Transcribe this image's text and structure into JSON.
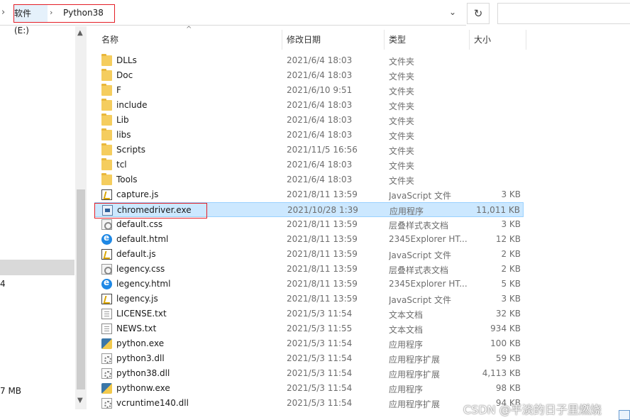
{
  "address": {
    "crumbs": [
      "软件 (E:)",
      "Python38"
    ],
    "separator": "›",
    "back_glyph": "›",
    "dropdown_glyph": "⌄",
    "refresh_glyph": "↻"
  },
  "nav": {
    "fragment_1": "4",
    "fragment_2": "7 MB"
  },
  "columns": {
    "name": "名称",
    "date": "修改日期",
    "type": "类型",
    "size": "大小",
    "sort_glyph": "^"
  },
  "files": [
    {
      "name": "DLLs",
      "date": "2021/6/4 18:03",
      "type": "文件夹",
      "size": "",
      "icon": "folder-icon"
    },
    {
      "name": "Doc",
      "date": "2021/6/4 18:03",
      "type": "文件夹",
      "size": "",
      "icon": "folder-icon"
    },
    {
      "name": "F",
      "date": "2021/6/10 9:51",
      "type": "文件夹",
      "size": "",
      "icon": "folder-icon"
    },
    {
      "name": "include",
      "date": "2021/6/4 18:03",
      "type": "文件夹",
      "size": "",
      "icon": "folder-icon"
    },
    {
      "name": "Lib",
      "date": "2021/6/4 18:03",
      "type": "文件夹",
      "size": "",
      "icon": "folder-icon"
    },
    {
      "name": "libs",
      "date": "2021/6/4 18:03",
      "type": "文件夹",
      "size": "",
      "icon": "folder-icon"
    },
    {
      "name": "Scripts",
      "date": "2021/11/5 16:56",
      "type": "文件夹",
      "size": "",
      "icon": "folder-icon"
    },
    {
      "name": "tcl",
      "date": "2021/6/4 18:03",
      "type": "文件夹",
      "size": "",
      "icon": "folder-icon"
    },
    {
      "name": "Tools",
      "date": "2021/6/4 18:03",
      "type": "文件夹",
      "size": "",
      "icon": "folder-icon"
    },
    {
      "name": "capture.js",
      "date": "2021/8/11 13:59",
      "type": "JavaScript 文件",
      "size": "3 KB",
      "icon": "js-file-icon"
    },
    {
      "name": "chromedriver.exe",
      "date": "2021/10/28 1:39",
      "type": "应用程序",
      "size": "11,011 KB",
      "icon": "exe-file-icon",
      "selected": true
    },
    {
      "name": "default.css",
      "date": "2021/8/11 13:59",
      "type": "层叠样式表文档",
      "size": "3 KB",
      "icon": "css-file-icon"
    },
    {
      "name": "default.html",
      "date": "2021/8/11 13:59",
      "type": "2345Explorer HT...",
      "size": "12 KB",
      "icon": "browser-file-icon"
    },
    {
      "name": "default.js",
      "date": "2021/8/11 13:59",
      "type": "JavaScript 文件",
      "size": "2 KB",
      "icon": "js-file-icon"
    },
    {
      "name": "legency.css",
      "date": "2021/8/11 13:59",
      "type": "层叠样式表文档",
      "size": "2 KB",
      "icon": "css-file-icon"
    },
    {
      "name": "legency.html",
      "date": "2021/8/11 13:59",
      "type": "2345Explorer HT...",
      "size": "5 KB",
      "icon": "browser-file-icon"
    },
    {
      "name": "legency.js",
      "date": "2021/8/11 13:59",
      "type": "JavaScript 文件",
      "size": "3 KB",
      "icon": "js-file-icon"
    },
    {
      "name": "LICENSE.txt",
      "date": "2021/5/3 11:54",
      "type": "文本文档",
      "size": "32 KB",
      "icon": "text-file-icon"
    },
    {
      "name": "NEWS.txt",
      "date": "2021/5/3 11:55",
      "type": "文本文档",
      "size": "934 KB",
      "icon": "text-file-icon"
    },
    {
      "name": "python.exe",
      "date": "2021/5/3 11:54",
      "type": "应用程序",
      "size": "100 KB",
      "icon": "python-exe-icon"
    },
    {
      "name": "python3.dll",
      "date": "2021/5/3 11:54",
      "type": "应用程序扩展",
      "size": "59 KB",
      "icon": "dll-file-icon"
    },
    {
      "name": "python38.dll",
      "date": "2021/5/3 11:54",
      "type": "应用程序扩展",
      "size": "4,113 KB",
      "icon": "dll-file-icon"
    },
    {
      "name": "pythonw.exe",
      "date": "2021/5/3 11:54",
      "type": "应用程序",
      "size": "98 KB",
      "icon": "python-exe-icon"
    },
    {
      "name": "vcruntime140.dll",
      "date": "2021/5/3 11:54",
      "type": "应用程序扩展",
      "size": "94 KB",
      "icon": "dll-file-icon"
    }
  ],
  "watermark": "CSDN @平淡的日子里燃烧",
  "colors": {
    "selection_bg": "#cce8ff",
    "selection_border": "#99d1ff",
    "annotation_red": "#e41e26",
    "folder": "#f5cd5e"
  }
}
